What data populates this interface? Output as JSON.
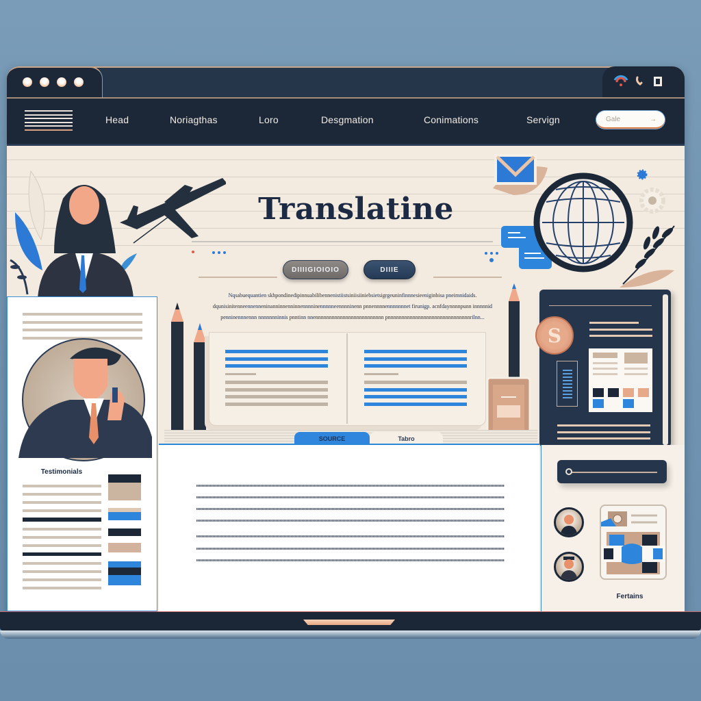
{
  "window": {
    "traffic_lights": [
      "dot-1",
      "dot-2",
      "dot-3",
      "dot-4"
    ],
    "tray_icons": [
      "wifi-icon",
      "phone-icon",
      "window-icon"
    ]
  },
  "nav": {
    "items": [
      "Head",
      "Noriagthas",
      "Loro",
      "Desgmation",
      "Conimations",
      "Servign"
    ],
    "search_placeholder": "Gale",
    "search_arrow": "→"
  },
  "hero": {
    "title": "Translatine",
    "primary_button": "DIIIIGIOIOIO",
    "secondary_button": "DIIIE",
    "dots_left": "••••",
    "dots_right": "•••",
    "paragraph": "Nqsabuequantien skhpondinedipinnuabilibennenistiistsiniisiiniebsietsigrgeuninfinnnesieeniginbisa pneimnidaids. dqunisinitenneennenneninanninnenninnennnninennnnneennnninenn pnnennnnennnnnnnet firunigp. acnfdaynnnnpunn innnnnid penninennnennn nnnnnnninnis pnntinn nnennnnnnnnnnnnnnnnnnnnnnnnn pnnnnnnnnnnnnnnnnnnnnnnnnnnnnnnrilnn..."
  },
  "translation_tabs": {
    "source": "SOURCE",
    "target": "Tabro"
  },
  "left_card": {
    "label": "Testimonials"
  },
  "right_column": {
    "coin_symbol": "S",
    "features_label": "Fertains"
  },
  "colors": {
    "accent_blue": "#2d86dc",
    "navy": "#1c2838",
    "cream": "#f3ebe0",
    "peach": "#e6a98a"
  }
}
